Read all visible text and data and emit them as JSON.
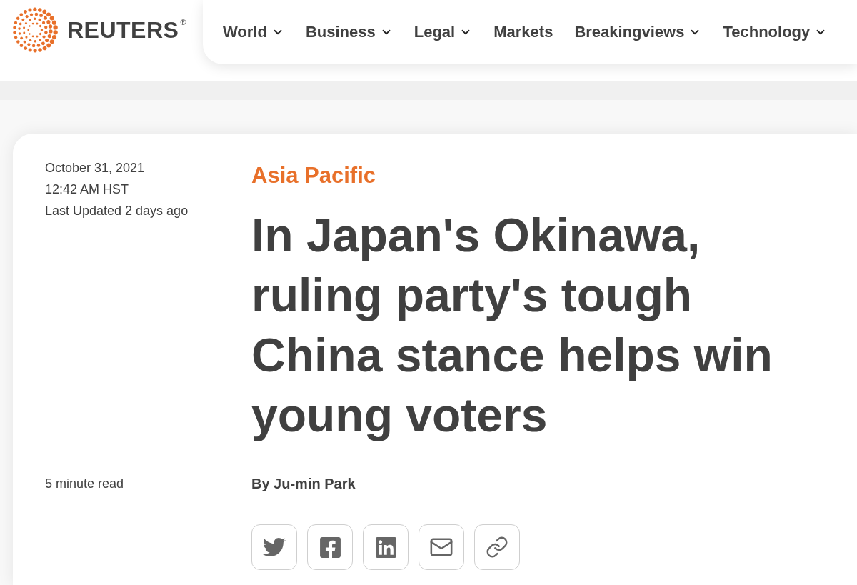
{
  "header": {
    "logo": {
      "wordmark": "REUTERS",
      "registered_mark": "®"
    },
    "nav": [
      {
        "label": "World",
        "dropdown": true
      },
      {
        "label": "Business",
        "dropdown": true
      },
      {
        "label": "Legal",
        "dropdown": true
      },
      {
        "label": "Markets",
        "dropdown": false
      },
      {
        "label": "Breakingviews",
        "dropdown": true
      },
      {
        "label": "Technology",
        "dropdown": true
      }
    ]
  },
  "article": {
    "date": "October 31, 2021",
    "time": "12:42 AM HST",
    "updated": "Last Updated 2 days ago",
    "read_time": "5 minute read",
    "section": "Asia Pacific",
    "headline": "In Japan's Okinawa, ruling party's tough China stance helps win young voters",
    "byline": "By Ju-min Park",
    "share_buttons": [
      {
        "kind": "twitter"
      },
      {
        "kind": "facebook"
      },
      {
        "kind": "linkedin"
      },
      {
        "kind": "email"
      },
      {
        "kind": "link"
      }
    ]
  }
}
